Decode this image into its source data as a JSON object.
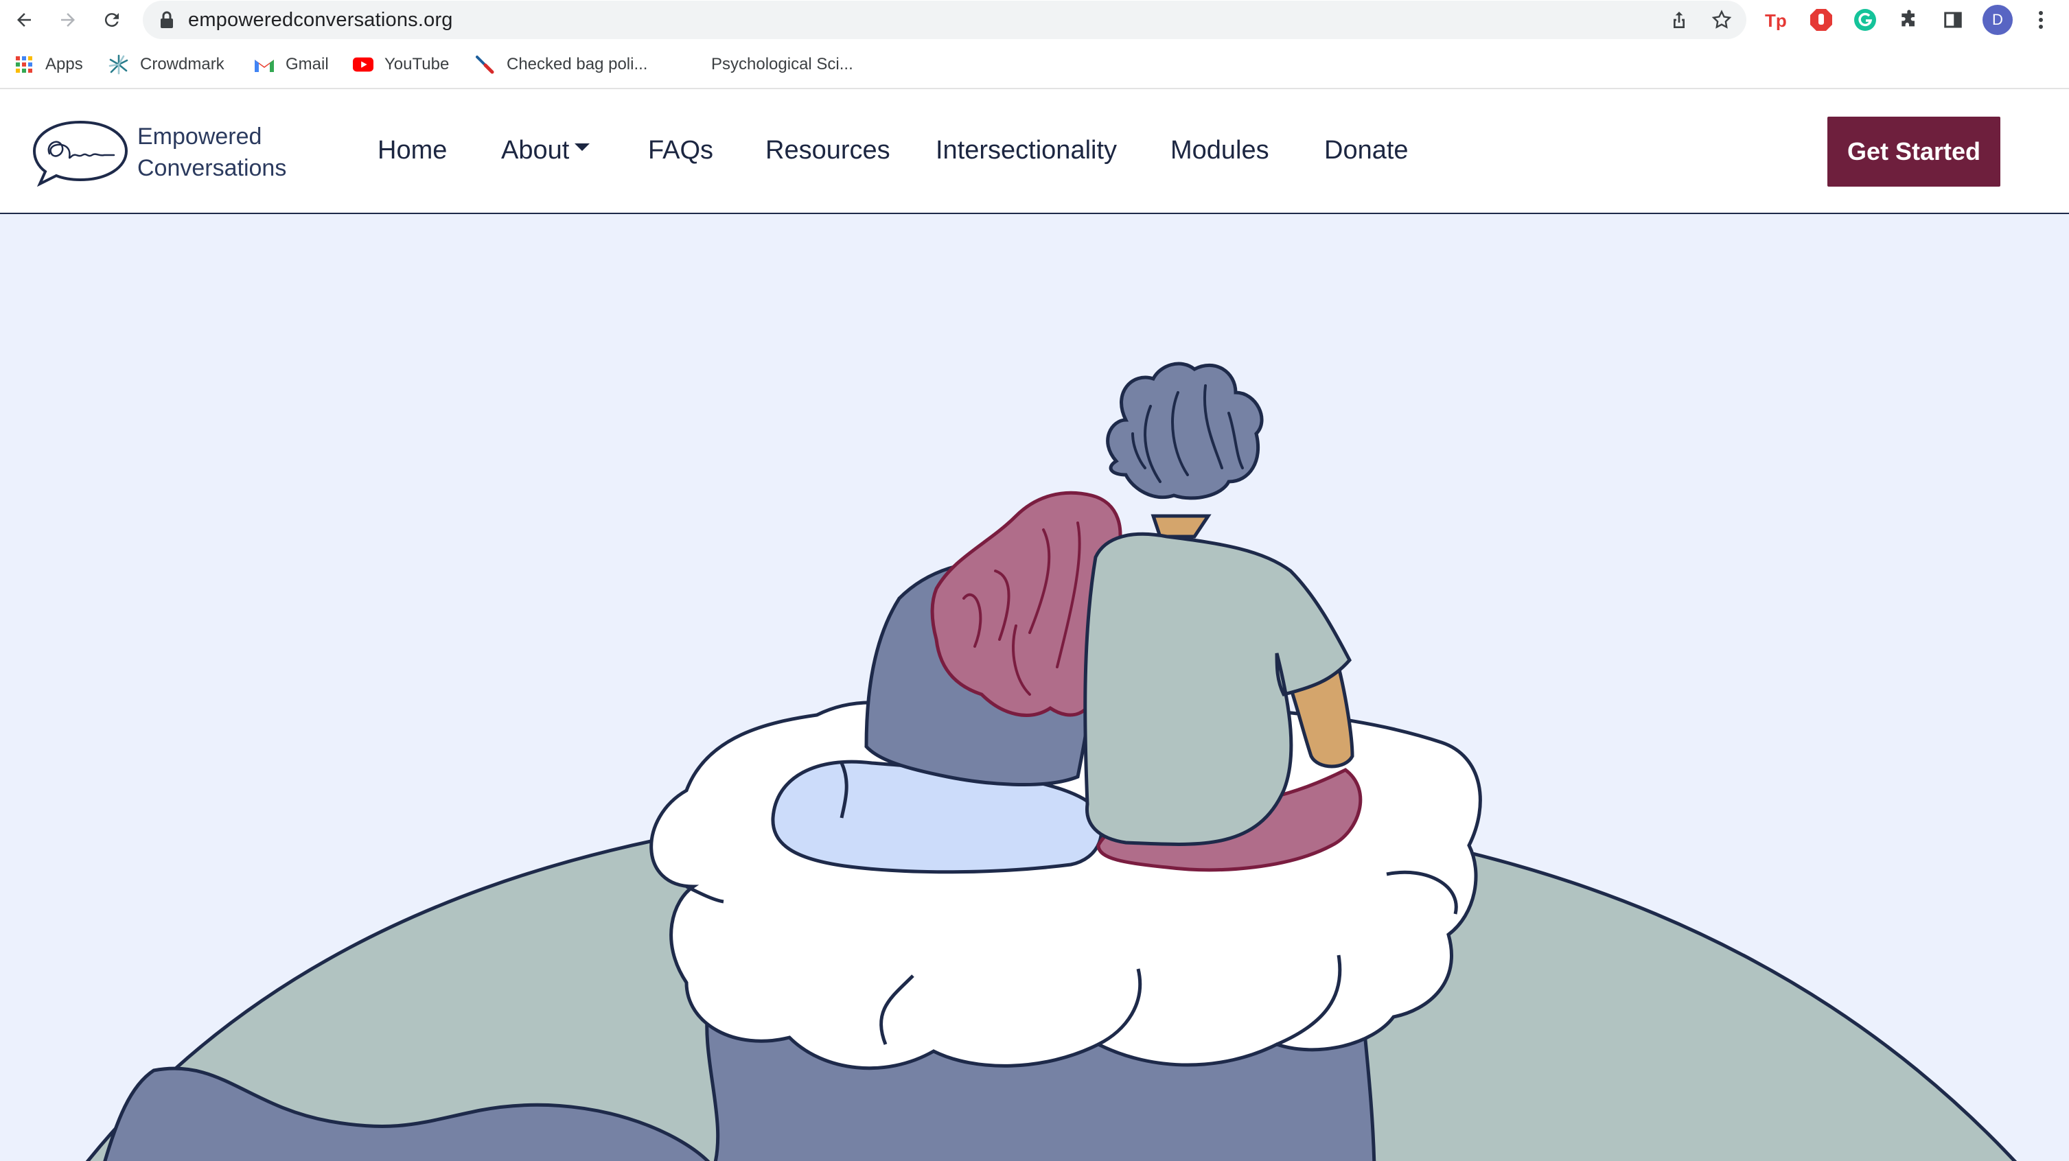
{
  "browser": {
    "url": "empoweredconversations.org",
    "profile_initial": "D",
    "icons": {
      "back": "arrow-left-icon",
      "forward": "arrow-right-icon",
      "reload": "reload-icon",
      "lock": "lock-icon",
      "share": "share-icon",
      "bookmark": "star-icon",
      "extensions": "puzzle-icon",
      "side_panel": "side-panel-icon",
      "menu": "kebab-menu-icon"
    }
  },
  "bookmarks": [
    {
      "label": "Apps",
      "icon": "apps-grid-icon"
    },
    {
      "label": "Crowdmark",
      "icon": "crowdmark-icon"
    },
    {
      "label": "Gmail",
      "icon": "gmail-icon"
    },
    {
      "label": "YouTube",
      "icon": "youtube-icon"
    },
    {
      "label": "Checked bag poli...",
      "icon": "airline-icon"
    },
    {
      "label": "Psychological Sci...",
      "icon": "blank-page-icon"
    }
  ],
  "site": {
    "brand": {
      "line1": "Empowered",
      "line2": "Conversations"
    },
    "nav": [
      "Home",
      "About",
      "FAQs",
      "Resources",
      "Intersectionality",
      "Modules",
      "Donate"
    ],
    "cta": "Get Started"
  },
  "colors": {
    "brand_maroon": "#6e1f3d",
    "navy": "#1e2a4a",
    "hero_bg": "#ecf1fd",
    "globe_green": "#b1c3c1",
    "globe_blue": "#7682a4"
  }
}
